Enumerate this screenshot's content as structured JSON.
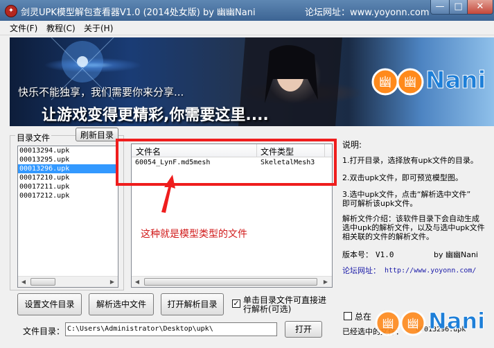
{
  "window": {
    "title": "剑灵UPK模型解包查看器V1.0 (2014处女版)    by 幽幽Nani",
    "forum": "论坛网址：www.yoyonn.com",
    "icon": "sword-app-icon",
    "controls": {
      "minimize": "—",
      "maximize": "□",
      "close": "✕"
    }
  },
  "menu": {
    "items": [
      "文件(F)",
      "教程(C)",
      "关于(H)"
    ]
  },
  "banner": {
    "line1": "快乐不能独享，我们需要你来分享...",
    "line2": "让游戏变得更精彩,你需要这里....",
    "logo_text": "Nani",
    "logo_color": "#ff8a1c",
    "logo_accent": "#1e7fd8"
  },
  "directory": {
    "label": "目录文件",
    "refresh_label": "刷新目录",
    "files": [
      "00013294.upk",
      "00013295.upk",
      "00013296.upk",
      "00017210.upk",
      "00017211.upk",
      "00017212.upk"
    ],
    "selected_index": 2
  },
  "detail": {
    "columns": [
      "文件名",
      "文件类型"
    ],
    "rows": [
      [
        "60054_LynF.md5mesh",
        "SkeletalMesh3"
      ]
    ],
    "annotation": "这种就是模型类型的文件",
    "highlight_color": "#ef1d1d"
  },
  "info": {
    "heading": "说明:",
    "step1": "1.打开目录，选择放有upk文件的目录。",
    "step2": "2.双击upk文件，即可预览模型图。",
    "step3a": "3.选中upk文件，点击“解析选中文件”",
    "step3b": "即可解析该upk文件。",
    "intro1": "解析文件介绍：该软件目录下会自动生成",
    "intro2": "选中upk的解析文件，以及与选中upk文件",
    "intro3": "相关联的文件的解析文件。",
    "version_label": "版本号：",
    "version": "V1.0",
    "author": "by 幽幽Nani",
    "forum_label": "论坛网址：",
    "forum_url": "http://www.yoyonn.com/"
  },
  "bottom": {
    "set_dir": "设置文件目录",
    "parse_selected": "解析选中文件",
    "open_parse_dir": "打开解析目录",
    "auto_parse_line1": "单击目录文件可直接进",
    "auto_parse_line2": "行解析(可选)",
    "auto_parse_checked": true,
    "path_label": "文件目录：",
    "path_value": "C:\\Users\\Administrator\\Desktop\\upk\\",
    "open_label": "打开",
    "always_label": "总在",
    "selected_label": "已经选中的文件：",
    "selected_value": "00013296.upk"
  }
}
